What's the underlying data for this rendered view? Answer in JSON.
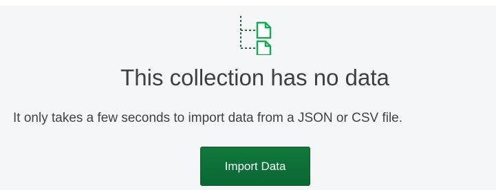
{
  "empty_state": {
    "icon": "documents-tree-icon",
    "title": "This collection has no data",
    "message": "It only takes a few seconds to import data from a JSON or CSV file.",
    "import_button_label": "Import Data"
  },
  "colors": {
    "accent_green": "#13aa52",
    "button_green": "#0d7237",
    "panel_background": "#f5f6f7"
  }
}
